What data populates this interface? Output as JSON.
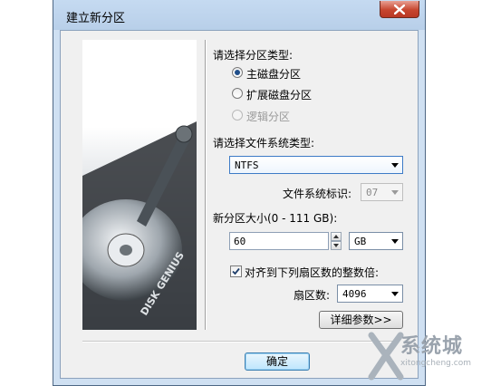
{
  "window": {
    "title": "建立新分区"
  },
  "partition_type": {
    "heading": "请选择分区类型:",
    "options": [
      {
        "label": "主磁盘分区",
        "checked": true,
        "disabled": false
      },
      {
        "label": "扩展磁盘分区",
        "checked": false,
        "disabled": false
      },
      {
        "label": "逻辑分区",
        "checked": false,
        "disabled": true
      }
    ]
  },
  "filesystem": {
    "heading": "请选择文件系统类型:",
    "value": "NTFS",
    "id_label": "文件系统标识:",
    "id_value": "07"
  },
  "size": {
    "heading": "新分区大小(0 - 111 GB):",
    "value": "60",
    "unit": "GB"
  },
  "alignment": {
    "checkbox_label": "对齐到下列扇区数的整数倍:",
    "checked": true,
    "sectors_label": "扇区数:",
    "sectors_value": "4096"
  },
  "buttons": {
    "details": "详细参数>>",
    "ok": "确定"
  },
  "image": {
    "disk_label": "DISK GENIUS"
  },
  "watermark": {
    "brand": "系统城",
    "sub": "xitongcheng.com"
  }
}
